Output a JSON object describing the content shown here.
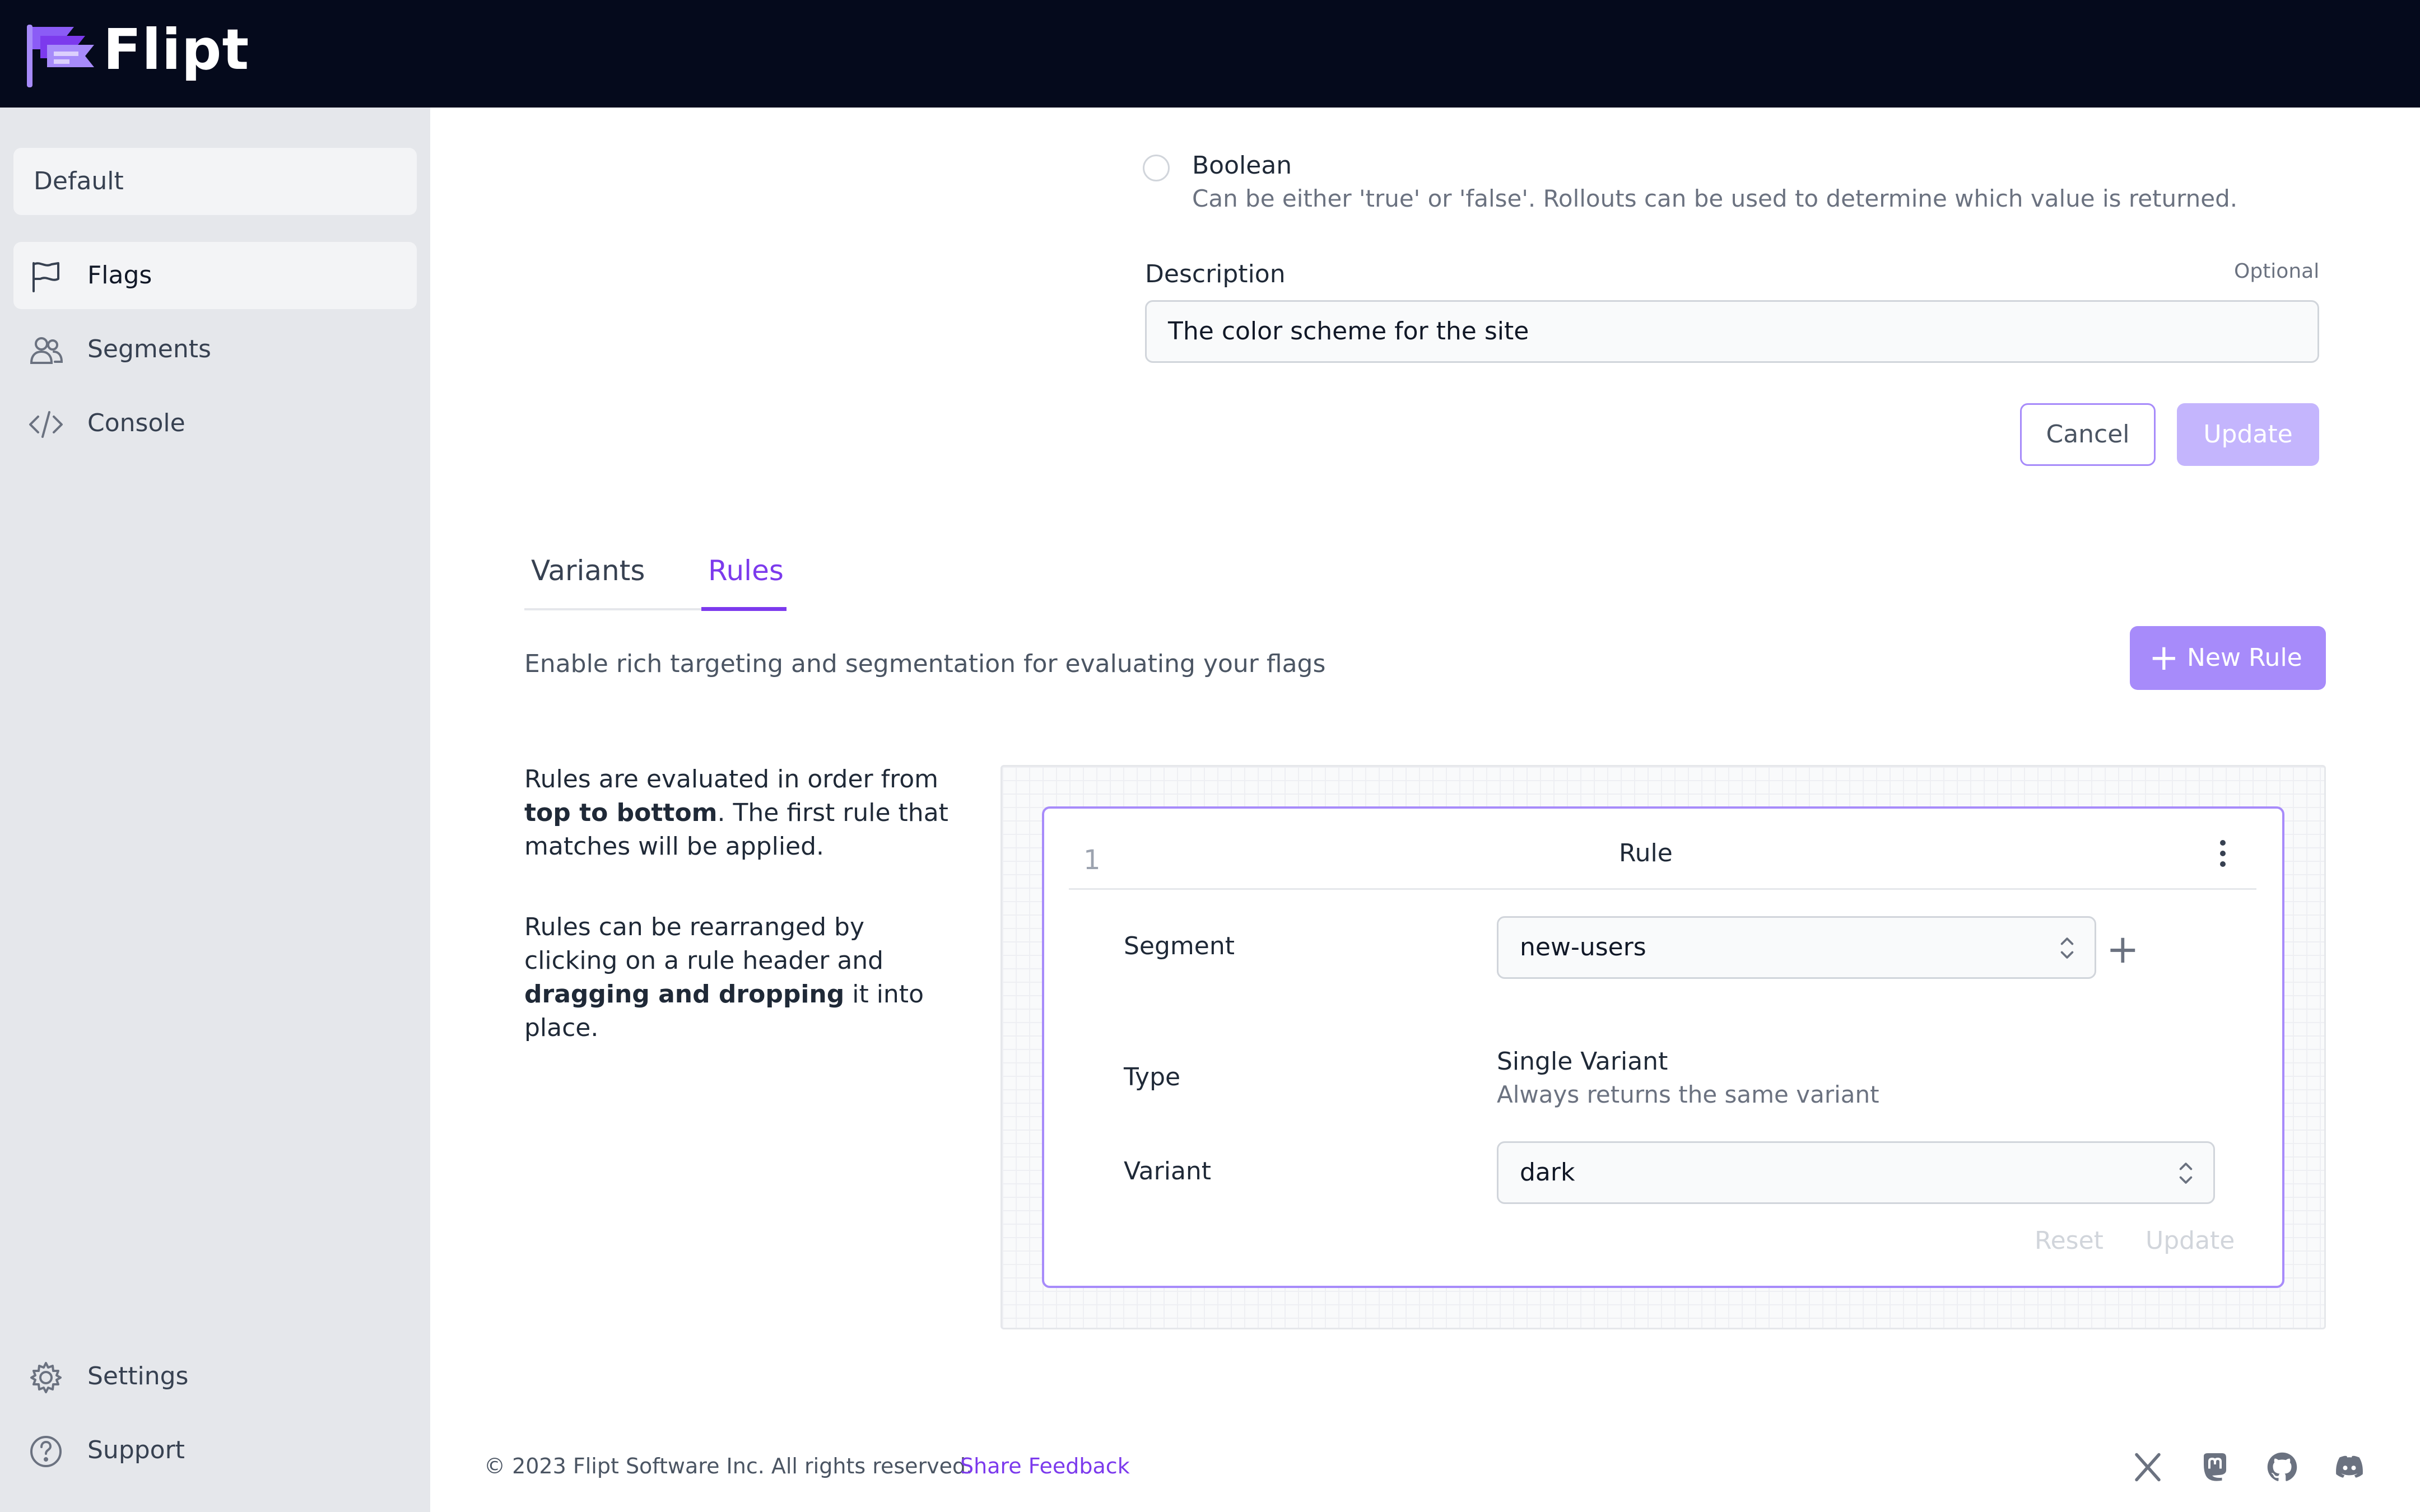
{
  "app": {
    "name": "Flipt"
  },
  "sidebar": {
    "namespace": "Default",
    "nav": [
      {
        "label": "Flags",
        "icon": "flag-icon",
        "active": true
      },
      {
        "label": "Segments",
        "icon": "users-icon",
        "active": false
      },
      {
        "label": "Console",
        "icon": "code-icon",
        "active": false
      }
    ],
    "bottom": [
      {
        "label": "Settings",
        "icon": "gear-icon"
      },
      {
        "label": "Support",
        "icon": "help-icon"
      }
    ]
  },
  "flag_form": {
    "type_option": {
      "label": "Boolean",
      "help": "Can be either 'true' or 'false'. Rollouts can be used to determine which value is returned.",
      "selected": false
    },
    "description": {
      "label": "Description",
      "optional": "Optional",
      "value": "The color scheme for the site"
    },
    "cancel_label": "Cancel",
    "update_label": "Update"
  },
  "tabs": [
    {
      "label": "Variants",
      "active": false
    },
    {
      "label": "Rules",
      "active": true
    }
  ],
  "rules": {
    "help": "Enable rich targeting and segmentation for evaluating your flags",
    "new_rule_label": "New Rule",
    "para1": {
      "a": "Rules are evaluated in order from ",
      "b": "top to bottom",
      "c": ". The first rule that matches will be applied."
    },
    "para2": {
      "a": "Rules can be rearranged by clicking on a rule header and ",
      "b": "dragging and dropping",
      "c": " it into place."
    },
    "rule": {
      "index": "1",
      "title": "Rule",
      "segment_label": "Segment",
      "segment_value": "new-users",
      "type_label": "Type",
      "type_value": "Single Variant",
      "type_help": "Always returns the same variant",
      "variant_label": "Variant",
      "variant_value": "dark",
      "reset_label": "Reset",
      "update_label": "Update"
    }
  },
  "footer": {
    "copyright": "© 2023 Flipt Software Inc. All rights reserved.",
    "feedback": "Share Feedback",
    "social": [
      "x-icon",
      "mastodon-icon",
      "github-icon",
      "discord-icon"
    ]
  },
  "colors": {
    "topbar": "#050a1c",
    "accent": "#7c3aed",
    "accent_light": "#a78bfa",
    "sidebar_bg": "#e5e7eb"
  }
}
